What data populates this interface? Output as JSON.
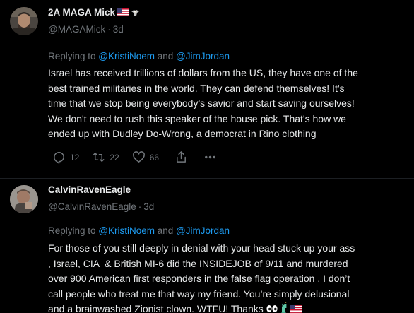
{
  "tweets": [
    {
      "display_name": "2A MAGA Mick",
      "handle": "@MAGAMick",
      "time": "3d",
      "replying_prefix": "Replying to ",
      "mention_1": "@KristiNoem",
      "replying_and": " and ",
      "mention_2": "@JimJordan",
      "text": "Israel has received trillions of dollars from the US, they have one of the\nbest trained militaries in the world. They can defend themselves! It's\ntime that we stop being everybody's savior and start saving ourselves!\nWe don't need to rush this speaker of the house pick. That's how we\nended up with Dudley Do-⁠Wrong, a democrat in Rino clothing⁠",
      "actions": {
        "reply_count": "12",
        "repost_count": "22",
        "like_count": "66"
      },
      "icons": [
        "us-flag-icon",
        "eagle-icon",
        "reply-icon",
        "repost-icon",
        "like-icon",
        "share-icon",
        "more-icon"
      ]
    },
    {
      "display_name": "CalvinRavenEagle",
      "handle": "@CalvinRavenEagle",
      "time": "3d",
      "replying_prefix": "Replying to ",
      "mention_1": "@KristiNoem",
      "replying_and": " and ",
      "mention_2": "@JimJordan",
      "text": "For those of you still deeply in denial with your head stuck up your ass\n, Israel, CIA  & British MI-6 did the INSIDEJOB of 9/11 and murdered\nover 900 American first responders in the false flag operation . I don’t\ncall people who treat me that way my friend. You’re simply delusional\nand a brainwashed Zionist clown⁠⁠. WTFU! Thanks ",
      "trailing_icons": [
        "eyes-icon",
        "statue-of-liberty-icon",
        "us-flag-icon"
      ]
    }
  ],
  "colors": {
    "background": "#000000",
    "text": "#e7e9ea",
    "secondary": "#71767b",
    "link": "#1d9bf0"
  }
}
